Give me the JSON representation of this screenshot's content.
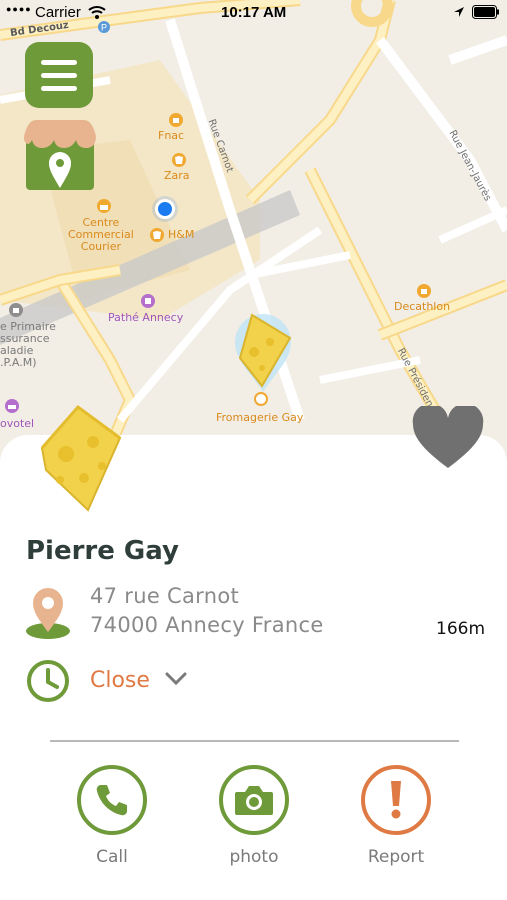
{
  "status_bar": {
    "carrier": "Carrier",
    "time": "10:17 AM"
  },
  "map": {
    "streets": [
      "Bd Decouz",
      "Rue Carnot",
      "Rue Jean-Jaurès",
      "Rue Présiden"
    ],
    "pois": {
      "fnac": "Fnac",
      "zara": "Zara",
      "centre_commercial": "Centre\nCommercial\nCourier",
      "hm": "H&M",
      "pathe": "Pathé Annecy",
      "decathlon": "Decathlon",
      "fromagerie": "Fromagerie Gay",
      "ecole": "e Primaire\nssurance\naladie\n.P.A.M)",
      "novotel": "ovotel"
    }
  },
  "shop": {
    "name": "Pierre Gay",
    "address_line1": "47 rue Carnot",
    "address_line2": "74000 Annecy France",
    "distance": "166m",
    "hours_status": "Close"
  },
  "actions": [
    {
      "label": "Call",
      "icon": "phone-icon"
    },
    {
      "label": "photo",
      "icon": "camera-icon"
    },
    {
      "label": "Report",
      "icon": "exclamation-icon"
    }
  ],
  "colors": {
    "accent_green": "#6f9a3a",
    "accent_orange": "#e07a45",
    "cheese_yellow": "#f2d24a",
    "favorite_gray": "#707070"
  }
}
